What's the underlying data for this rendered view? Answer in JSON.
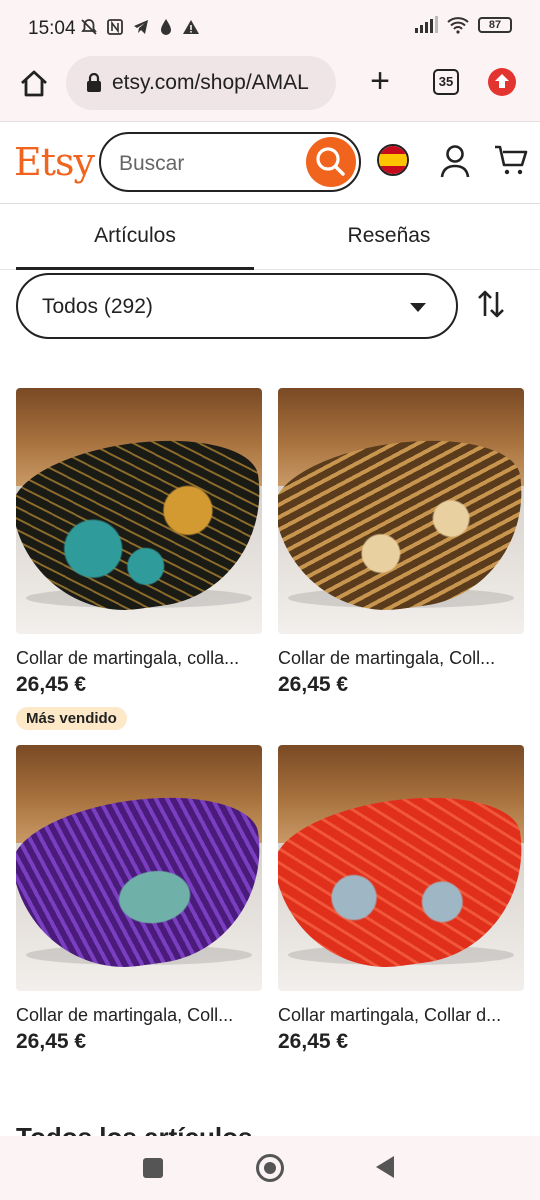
{
  "status_bar": {
    "time": "15:04",
    "battery": "87"
  },
  "browser": {
    "url": "etsy.com/shop/AMAL",
    "tab_count": "35"
  },
  "header": {
    "logo": "Etsy",
    "search_placeholder": "Buscar"
  },
  "tabs": [
    {
      "label": "Artículos",
      "active": true
    },
    {
      "label": "Reseñas",
      "active": false
    }
  ],
  "filter": {
    "selected": "Todos (292)"
  },
  "products": [
    {
      "title": "Collar de martingala, colla...",
      "price": "26,45 €",
      "badge": "Más vendido",
      "colors": [
        "#1b1b16",
        "#2f9b9b",
        "#d39a32"
      ]
    },
    {
      "title": "Collar de martingala, Coll...",
      "price": "26,45 €",
      "badge": "",
      "colors": [
        "#5a3c1c",
        "#c8954e",
        "#e8d0a0"
      ]
    },
    {
      "title": "Collar de martingala, Coll...",
      "price": "26,45 €",
      "badge": "",
      "colors": [
        "#4a1b7a",
        "#7a3fc0",
        "#6fb0a8"
      ]
    },
    {
      "title": "Collar martingala, Collar d...",
      "price": "26,45 €",
      "badge": "",
      "colors": [
        "#e0301c",
        "#f0563a",
        "#9fb7c4"
      ]
    }
  ],
  "section": {
    "title": "Todos los artículos"
  },
  "accent_color": "#f1641e"
}
